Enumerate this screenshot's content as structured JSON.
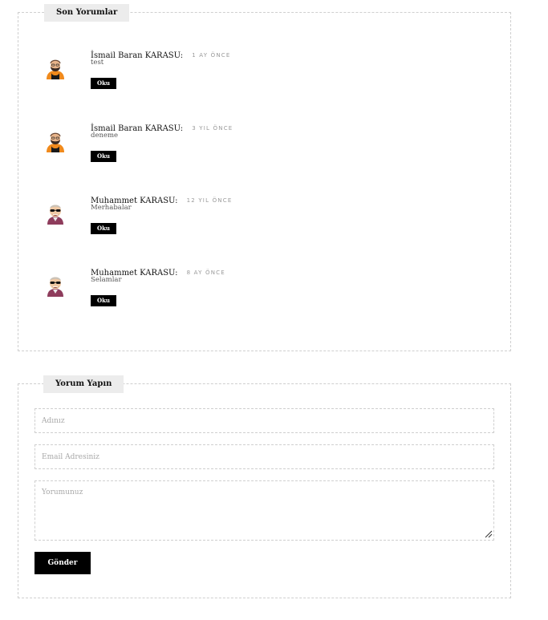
{
  "recent_comments": {
    "title": "Son Yorumlar",
    "items": [
      {
        "name": "İsmail Baran KARASU:",
        "time": "1 AY ÖNCE",
        "text": "test",
        "button": "Oku",
        "avatar": "avatar-orange-bearded-man"
      },
      {
        "name": "İsmail Baran KARASU:",
        "time": "3 YIL ÖNCE",
        "text": "deneme",
        "button": "Oku",
        "avatar": "avatar-orange-bearded-man"
      },
      {
        "name": "Muhammet KARASU:",
        "time": "12 YIL ÖNCE",
        "text": "Merhabalar",
        "button": "Oku",
        "avatar": "avatar-sunglasses-man"
      },
      {
        "name": "Muhammet KARASU:",
        "time": "8 AY ÖNCE",
        "text": "Selamlar",
        "button": "Oku",
        "avatar": "avatar-sunglasses-man"
      }
    ]
  },
  "comment_form": {
    "title": "Yorum Yapın",
    "name_placeholder": "Adınız",
    "email_placeholder": "Email Adresiniz",
    "message_placeholder": "Yorumunuz",
    "submit_label": "Gönder"
  }
}
